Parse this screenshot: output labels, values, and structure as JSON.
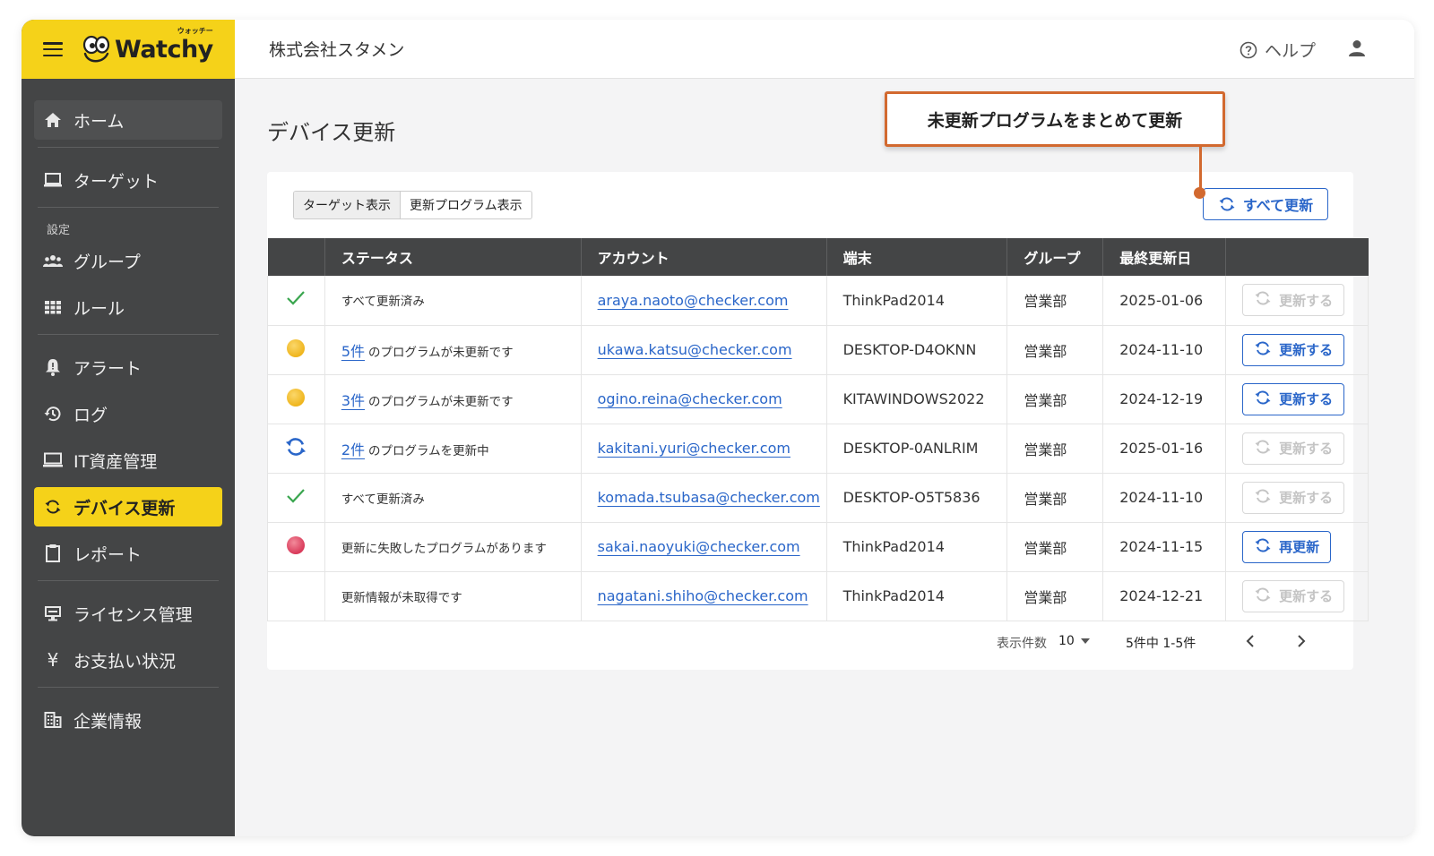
{
  "app": {
    "logo_text": "Watchy",
    "logo_kana": "ウォッチー",
    "company": "株式会社スタメン",
    "help_label": "ヘルプ"
  },
  "sidebar": {
    "items": [
      {
        "label": "ホーム",
        "icon": "home-icon"
      },
      {
        "label": "ターゲット",
        "icon": "laptop-icon"
      },
      {
        "label": "グループ",
        "icon": "group-icon"
      },
      {
        "label": "ルール",
        "icon": "grid-icon"
      },
      {
        "label": "アラート",
        "icon": "bell-icon"
      },
      {
        "label": "ログ",
        "icon": "history-icon"
      },
      {
        "label": "IT資産管理",
        "icon": "monitor-icon"
      },
      {
        "label": "デバイス更新",
        "icon": "sync-icon"
      },
      {
        "label": "レポート",
        "icon": "clipboard-icon"
      },
      {
        "label": "ライセンス管理",
        "icon": "license-icon"
      },
      {
        "label": "お支払い状況",
        "icon": "yen-icon"
      },
      {
        "label": "企業情報",
        "icon": "building-icon"
      }
    ],
    "section_label": "設定",
    "active": "デバイス更新"
  },
  "page": {
    "title": "デバイス更新",
    "callout": "未更新プログラムをまとめて更新",
    "view_toggle": [
      "ターゲット表示",
      "更新プログラム表示"
    ],
    "update_all_label": "すべて更新"
  },
  "table": {
    "headers": [
      "",
      "ステータス",
      "アカウント",
      "端末",
      "グループ",
      "最終更新日",
      ""
    ],
    "rows": [
      {
        "status_icon": "check-icon",
        "count": "",
        "status": "すべて更新済み",
        "account": "araya.naoto@checker.com",
        "device": "ThinkPad2014",
        "group": "営業部",
        "date": "2025-01-06",
        "action": "更新する",
        "enabled": false
      },
      {
        "status_icon": "yellow-dot-icon",
        "count": "5件",
        "status": "のプログラムが未更新です",
        "account": "ukawa.katsu@checker.com",
        "device": "DESKTOP-D4OKNN",
        "group": "営業部",
        "date": "2024-11-10",
        "action": "更新する",
        "enabled": true
      },
      {
        "status_icon": "yellow-dot-icon",
        "count": "3件",
        "status": "のプログラムが未更新です",
        "account": "ogino.reina@checker.com",
        "device": "KITAWINDOWS2022",
        "group": "営業部",
        "date": "2024-12-19",
        "action": "更新する",
        "enabled": true
      },
      {
        "status_icon": "sync-icon",
        "count": "2件",
        "status": "のプログラムを更新中",
        "account": "kakitani.yuri@checker.com",
        "device": "DESKTOP-0ANLRIM",
        "group": "営業部",
        "date": "2025-01-16",
        "action": "更新する",
        "enabled": false
      },
      {
        "status_icon": "check-icon",
        "count": "",
        "status": "すべて更新済み",
        "account": "komada.tsubasa@checker.com",
        "device": "DESKTOP-O5T5836",
        "group": "営業部",
        "date": "2024-11-10",
        "action": "更新する",
        "enabled": false
      },
      {
        "status_icon": "red-dot-icon",
        "count": "",
        "status": "更新に失敗したプログラムがあります",
        "account": "sakai.naoyuki@checker.com",
        "device": "ThinkPad2014",
        "group": "営業部",
        "date": "2024-11-15",
        "action": "再更新",
        "enabled": true
      },
      {
        "status_icon": "",
        "count": "",
        "status": "更新情報が未取得です",
        "account": "nagatani.shiho@checker.com",
        "device": "ThinkPad2014",
        "group": "営業部",
        "date": "2024-12-21",
        "action": "更新する",
        "enabled": false
      }
    ]
  },
  "pagination": {
    "per_page_label": "表示件数",
    "per_page_value": "10",
    "range_label": "5件中 1-5件"
  },
  "colors": {
    "brand_yellow": "#f5d219",
    "sidebar_bg": "#444546",
    "accent_blue": "#2a66c9",
    "callout_orange": "#d2692f"
  }
}
